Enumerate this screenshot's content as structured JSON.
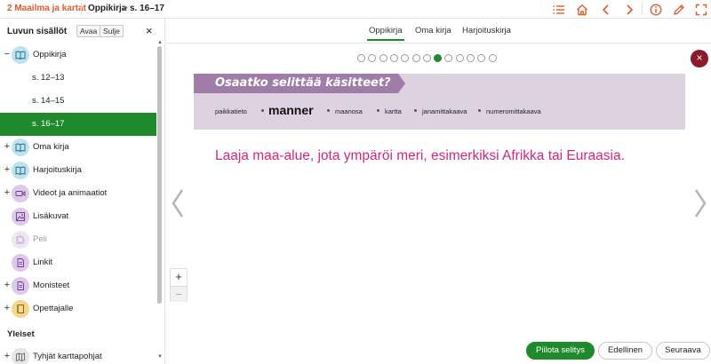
{
  "header": {
    "chapter": "2 Maailma ja kartat",
    "book": "Oppikirja",
    "arrow": ">",
    "page": "s. 16–17",
    "icons": [
      "list-icon",
      "home-icon",
      "chevron-left-icon",
      "chevron-right-icon",
      "info-icon",
      "pen-icon",
      "fullscreen-icon"
    ],
    "accent_color": "#e05a2b"
  },
  "sidebar": {
    "title": "Luvun sisällöt",
    "open_label": "Avaa",
    "close_label": "Sulje",
    "close_icon": "×",
    "items": [
      {
        "toggle": "−",
        "label": "Oppikirja",
        "icon": "book-icon"
      },
      {
        "label": "s. 12–13"
      },
      {
        "label": "s. 14–15"
      },
      {
        "label": "s. 16–17"
      },
      {
        "toggle": "+",
        "label": "Oma kirja",
        "icon": "book-icon"
      },
      {
        "toggle": "+",
        "label": "Harjoituskirja",
        "icon": "book-icon"
      },
      {
        "toggle": "+",
        "label": "Videot ja animaatiot",
        "icon": "video-icon"
      },
      {
        "label": "Lisäkuvat",
        "icon": "image-icon"
      },
      {
        "label": "Peli",
        "icon": "puzzle-icon"
      },
      {
        "label": "Linkit",
        "icon": "document-icon"
      },
      {
        "toggle": "+",
        "label": "Monisteet",
        "icon": "document-icon"
      },
      {
        "toggle": "+",
        "label": "Opettajalle",
        "icon": "binder-icon"
      }
    ],
    "section_title": "Yleiset",
    "general_items": [
      {
        "toggle": "+",
        "label": "Tyhjät karttapohjat",
        "icon": "map-icon"
      }
    ],
    "active_color": "#1f8a2b"
  },
  "tabs": [
    {
      "label": "Oppikirja",
      "active": true
    },
    {
      "label": "Oma kirja"
    },
    {
      "label": "Harjoituskirja"
    }
  ],
  "pager": {
    "total": 13,
    "current": 8
  },
  "card": {
    "title": "Osaatko selittää käsitteet?",
    "words": [
      "paikkatieto",
      "manner",
      "maanosa",
      "kartta",
      "janamittakaava",
      "numeromittakaava"
    ],
    "highlighted": "manner",
    "title_color": "#a07ca9",
    "background_color": "#ddd2df"
  },
  "definition": "Laaja maa-alue, jota ympäröi meri, esimerkiksi Afrikka tai Euraasia.",
  "definition_color": "#d4267f",
  "zoom": {
    "plus": "+",
    "minus": "−"
  },
  "buttons": {
    "hide": "Piilota selitys",
    "previous": "Edellinen",
    "next": "Seuraava"
  },
  "close_icon": "×"
}
